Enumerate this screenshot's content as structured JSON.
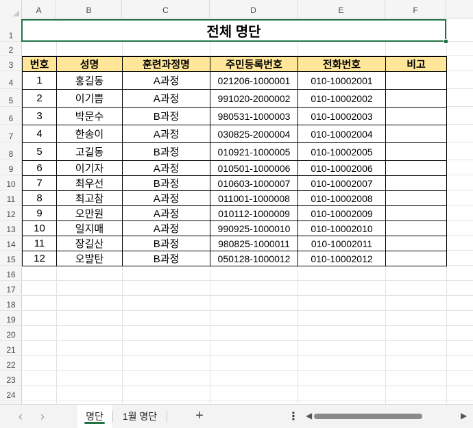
{
  "columns": [
    "A",
    "B",
    "C",
    "D",
    "E",
    "F"
  ],
  "rows": [
    "1",
    "2",
    "3",
    "4",
    "5",
    "6",
    "7",
    "8",
    "9",
    "10",
    "11",
    "12",
    "13",
    "14",
    "15",
    "16",
    "17",
    "18",
    "19",
    "20",
    "21",
    "22",
    "23",
    "24"
  ],
  "title": "전체 명단",
  "table": {
    "headers": [
      "번호",
      "성명",
      "훈련과정명",
      "주민등록번호",
      "전화번호",
      "비고"
    ],
    "rows": [
      [
        "1",
        "홍길동",
        "A과정",
        "021206-1000001",
        "010-10002001",
        ""
      ],
      [
        "2",
        "이기쁨",
        "A과정",
        "991020-2000002",
        "010-10002002",
        ""
      ],
      [
        "3",
        "박문수",
        "B과정",
        "980531-1000003",
        "010-10002003",
        ""
      ],
      [
        "4",
        "한송이",
        "A과정",
        "030825-2000004",
        "010-10002004",
        ""
      ],
      [
        "5",
        "고길동",
        "B과정",
        "010921-1000005",
        "010-10002005",
        ""
      ],
      [
        "6",
        "이기자",
        "A과정",
        "010501-1000006",
        "010-10002006",
        ""
      ],
      [
        "7",
        "최우선",
        "B과정",
        "010603-1000007",
        "010-10002007",
        ""
      ],
      [
        "8",
        "최고참",
        "A과정",
        "011001-1000008",
        "010-10002008",
        ""
      ],
      [
        "9",
        "오만원",
        "A과정",
        "010112-1000009",
        "010-10002009",
        ""
      ],
      [
        "10",
        "일지매",
        "A과정",
        "990925-1000010",
        "010-10002010",
        ""
      ],
      [
        "11",
        "장길산",
        "B과정",
        "980825-1000011",
        "010-10002011",
        ""
      ],
      [
        "12",
        "오발탄",
        "B과정",
        "050128-1000012",
        "010-10002012",
        ""
      ]
    ]
  },
  "tabs": {
    "nav_prev": "‹",
    "nav_next": "›",
    "active": "명단",
    "second": "1월 명단",
    "add": "+",
    "more": "⋮"
  },
  "colors": {
    "header_fill": "#ffe699",
    "selection": "#217346"
  },
  "icons": [
    "chevron-left-icon",
    "chevron-right-icon",
    "plus-icon",
    "more-icon",
    "scroll-left-icon",
    "scroll-right-icon"
  ]
}
